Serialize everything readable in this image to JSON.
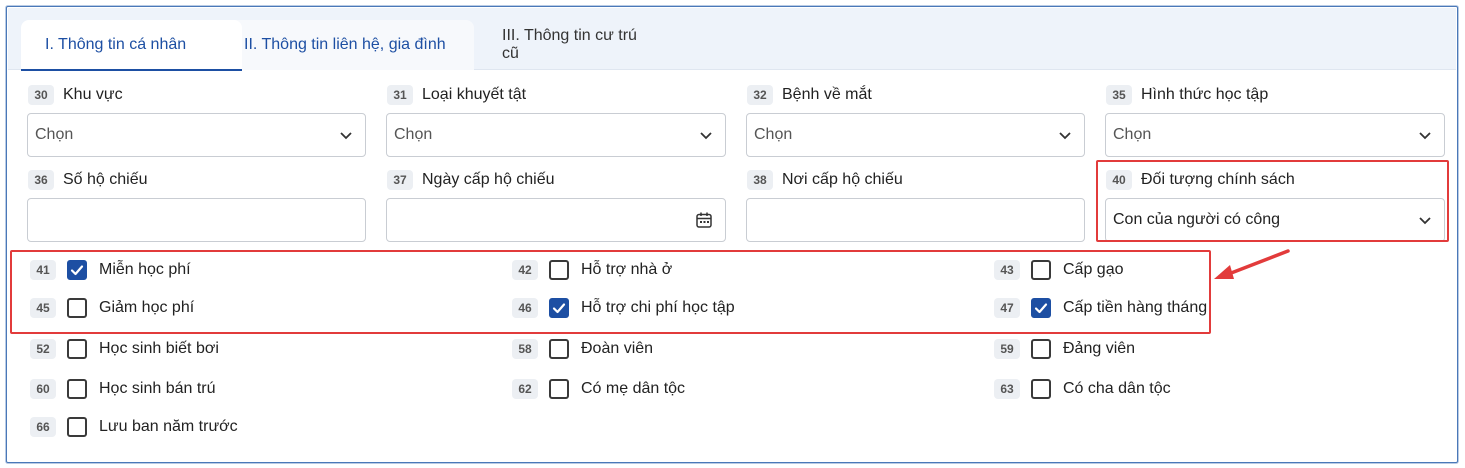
{
  "tabs": [
    {
      "label": "I. Thông tin cá nhân"
    },
    {
      "label": "II. Thông tin liên hệ, gia đình"
    },
    {
      "label": "III. Thông tin cư trú cũ"
    }
  ],
  "fields": {
    "khu_vuc": {
      "num": "30",
      "label": "Khu vực",
      "value": "Chọn"
    },
    "loai_khuyet_tat": {
      "num": "31",
      "label": "Loại khuyết tật",
      "value": "Chọn"
    },
    "benh_ve_mat": {
      "num": "32",
      "label": "Bệnh về mắt",
      "value": "Chọn"
    },
    "hinh_thuc_hoc_tap": {
      "num": "35",
      "label": "Hình thức học tập",
      "value": "Chọn"
    },
    "so_ho_chieu": {
      "num": "36",
      "label": "Số hộ chiếu",
      "value": ""
    },
    "ngay_cap_ho_chieu": {
      "num": "37",
      "label": "Ngày cấp hộ chiếu",
      "value": ""
    },
    "noi_cap_ho_chieu": {
      "num": "38",
      "label": "Nơi cấp hộ chiếu",
      "value": ""
    },
    "doi_tuong_chinh_sach": {
      "num": "40",
      "label": "Đối tượng chính sách",
      "value": "Con của người có công"
    }
  },
  "checkboxes": [
    {
      "num": "41",
      "label": "Miễn học phí",
      "checked": true
    },
    {
      "num": "42",
      "label": "Hỗ trợ nhà ở",
      "checked": false
    },
    {
      "num": "43",
      "label": "Cấp gạo",
      "checked": false
    },
    {
      "num": "45",
      "label": "Giảm học phí",
      "checked": false
    },
    {
      "num": "46",
      "label": "Hỗ trợ chi phí học tập",
      "checked": true
    },
    {
      "num": "47",
      "label": "Cấp tiền hàng tháng",
      "checked": true
    },
    {
      "num": "52",
      "label": "Học sinh biết bơi",
      "checked": false
    },
    {
      "num": "58",
      "label": "Đoàn viên",
      "checked": false
    },
    {
      "num": "59",
      "label": "Đảng viên",
      "checked": false
    },
    {
      "num": "60",
      "label": "Học sinh bán trú",
      "checked": false
    },
    {
      "num": "62",
      "label": "Có mẹ dân tộc",
      "checked": false
    },
    {
      "num": "63",
      "label": "Có cha dân tộc",
      "checked": false
    },
    {
      "num": "66",
      "label": "Lưu ban năm trước",
      "checked": false
    }
  ],
  "icons": {
    "dropdown": "chevron-down-icon",
    "date": "calendar-icon",
    "check": "checkmark-icon",
    "annotation": "red-arrow-icon"
  },
  "colors": {
    "accent": "#1d4fa3",
    "highlight": "#e23b3b"
  }
}
